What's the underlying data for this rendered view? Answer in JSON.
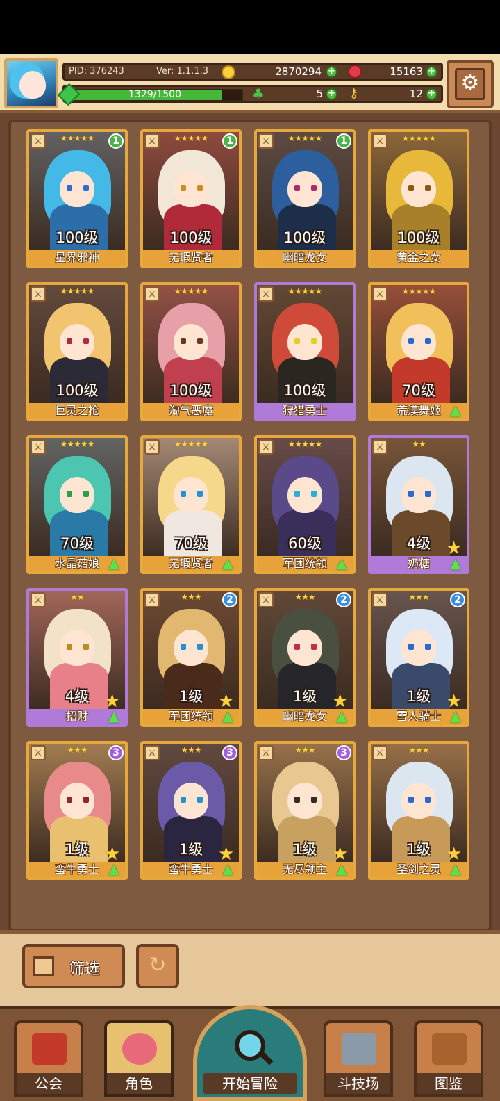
{
  "header": {
    "pid_label": "PID: 376243",
    "version_label": "Ver: 1.1.1.3",
    "gold": "2870294",
    "gems": "15163",
    "xp_text": "1329/1500",
    "xp_fraction": 0.886,
    "clover": "5",
    "keys": "12"
  },
  "cards": [
    {
      "name": "星界邪神",
      "level": "100级",
      "stars": "★★★★★",
      "badge": "1",
      "frame": "gold",
      "hair": "#44b8e6",
      "body": "#2c6ea8",
      "eye": "#2a6fd0"
    },
    {
      "name": "无瑕贤者",
      "level": "100级",
      "stars": "★★★★★",
      "badge": "1",
      "frame": "gold",
      "hair": "#f2e6d6",
      "body": "#b02a3a",
      "eye": "#c99020"
    },
    {
      "name": "幽暗龙女",
      "level": "100级",
      "stars": "★★★★★",
      "badge": "1",
      "frame": "gold",
      "hair": "#2d5e9e",
      "body": "#1c2e4a",
      "eye": "#b02a6a"
    },
    {
      "name": "黄金之女",
      "level": "100级",
      "stars": "★★★★★",
      "badge": "",
      "frame": "gold",
      "hair": "#e8b83a",
      "body": "#a8802a",
      "eye": "#8a5a10"
    },
    {
      "name": "巨灵之枪",
      "level": "100级",
      "stars": "★★★★★",
      "badge": "",
      "frame": "gold",
      "hair": "#f2c470",
      "body": "#2c2a36",
      "eye": "#b02a3a"
    },
    {
      "name": "淘气恶魔",
      "level": "100级",
      "stars": "★★★★★",
      "badge": "",
      "frame": "gold",
      "hair": "#e8a0a8",
      "body": "#c04050",
      "eye": "#6a3a20"
    },
    {
      "name": "狩猎勇士",
      "level": "100级",
      "stars": "★★★★★",
      "badge": "",
      "frame": "purple",
      "hair": "#d04a3a",
      "body": "#2a2620",
      "eye": "#e0d020"
    },
    {
      "name": "荒漠舞姬",
      "level": "70级",
      "stars": "★★★★★",
      "badge": "",
      "frame": "gold",
      "hair": "#f2c05a",
      "body": "#c43a2a",
      "eye": "#2a6ad0",
      "up": true
    },
    {
      "name": "水晶菇娘",
      "level": "70级",
      "stars": "★★★★★",
      "badge": "",
      "frame": "gold",
      "hair": "#4cc6b0",
      "body": "#2a7aa8",
      "eye": "#2aa04a",
      "up": true
    },
    {
      "name": "无瑕贤者",
      "level": "70级",
      "stars": "★★★★★",
      "badge": "",
      "frame": "gold",
      "hair": "#f6d88a",
      "body": "#f0e8e0",
      "eye": "#2a90d0",
      "up": true
    },
    {
      "name": "军团统领",
      "level": "60级",
      "stars": "★★★★★",
      "badge": "",
      "frame": "gold",
      "hair": "#5a4a8a",
      "body": "#3a2e5a",
      "eye": "#2ab0d0",
      "up": true
    },
    {
      "name": "奶糖",
      "level": "4级",
      "stars": "★★",
      "badge": "",
      "frame": "purple",
      "hair": "#dce6f0",
      "body": "#6a4a2a",
      "eye": "#2a6ad0",
      "up": true,
      "upstar": true
    },
    {
      "name": "招财",
      "level": "4级",
      "stars": "★★",
      "badge": "",
      "frame": "purple",
      "hair": "#f2e2c8",
      "body": "#e8808a",
      "eye": "#c08a20",
      "up": true,
      "upstar": true
    },
    {
      "name": "军团统领",
      "level": "1级",
      "stars": "★★★",
      "badge": "2",
      "frame": "gold",
      "hair": "#e2b870",
      "body": "#4a2a1a",
      "eye": "#2a90d0",
      "up": true,
      "upstar": true
    },
    {
      "name": "幽暗龙女",
      "level": "1级",
      "stars": "★★★",
      "badge": "2",
      "frame": "gold",
      "hair": "#4a5040",
      "body": "#26262a",
      "eye": "#c0304a",
      "up": true,
      "upstar": true
    },
    {
      "name": "雪人骑士",
      "level": "1级",
      "stars": "★★★",
      "badge": "2",
      "frame": "gold",
      "hair": "#dce8f6",
      "body": "#3a4a6a",
      "eye": "#2a6ad0",
      "up": true,
      "upstar": true
    },
    {
      "name": "蛮牛勇士",
      "level": "1级",
      "stars": "★★★",
      "badge": "3",
      "frame": "gold",
      "hair": "#e88a8a",
      "body": "#e8c070",
      "eye": "#8a2a2a",
      "up": true,
      "upstar": true
    },
    {
      "name": "蛮牛勇士",
      "level": "1级",
      "stars": "★★★",
      "badge": "3",
      "frame": "gold",
      "hair": "#6a5aa8",
      "body": "#2a2640",
      "eye": "#2a90d0",
      "up": true,
      "upstar": true
    },
    {
      "name": "无尽领主",
      "level": "1级",
      "stars": "★★★",
      "badge": "3",
      "frame": "gold",
      "hair": "#e8c890",
      "body": "#c8a060",
      "eye": "#3a2a1a",
      "up": true,
      "upstar": true
    },
    {
      "name": "圣剑之灵",
      "level": "1级",
      "stars": "★★★",
      "badge": "",
      "frame": "gold",
      "hair": "#dce6f0",
      "body": "#c89a5a",
      "eye": "#2a6ad0",
      "up": true,
      "upstar": true
    }
  ],
  "filter_label": "筛选",
  "nav": [
    {
      "label": "公会",
      "icon": "guild-icon"
    },
    {
      "label": "角色",
      "icon": "character-icon",
      "active": true
    },
    {
      "label": "开始冒险",
      "icon": "adventure-icon"
    },
    {
      "label": "斗技场",
      "icon": "arena-icon"
    },
    {
      "label": "图鉴",
      "icon": "codex-icon"
    }
  ]
}
